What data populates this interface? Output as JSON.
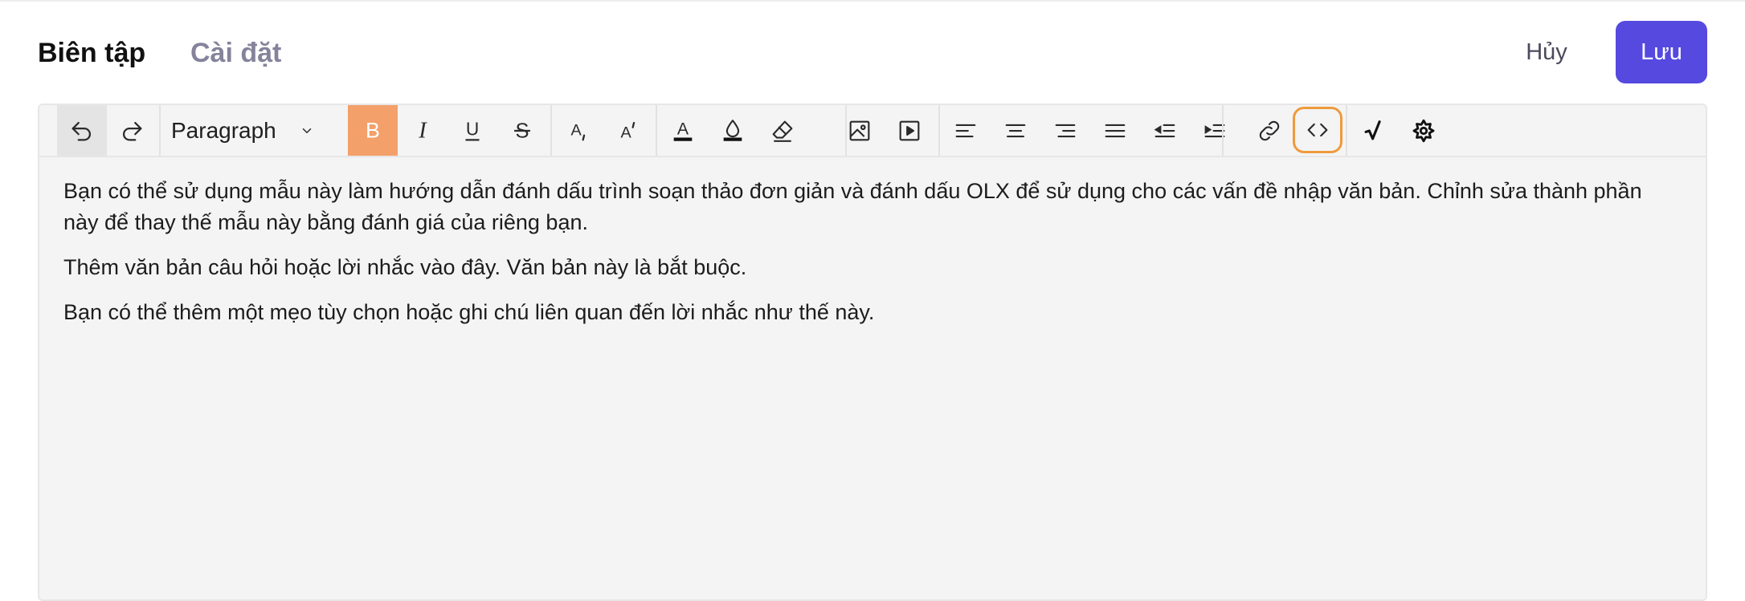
{
  "header": {
    "tabs": [
      {
        "label": "Biên tập",
        "active": true
      },
      {
        "label": "Cài đặt",
        "active": false
      }
    ],
    "cancel_label": "Hủy",
    "save_label": "Lưu"
  },
  "toolbar": {
    "block_format": "Paragraph",
    "buttons": [
      "undo-icon",
      "redo-icon",
      "bold-icon",
      "italic-icon",
      "underline-icon",
      "strikethrough-icon",
      "subscript-icon",
      "superscript-icon",
      "text-color-icon",
      "highlight-icon",
      "eraser-icon",
      "image-icon",
      "video-icon",
      "align-left-icon",
      "align-center-icon",
      "align-right-icon",
      "align-justify-icon",
      "outdent-icon",
      "indent-icon",
      "link-icon",
      "code-icon",
      "math-icon",
      "settings-icon"
    ],
    "letters": {
      "bold": "B",
      "italic": "I",
      "underline": "U",
      "strike": "S",
      "sub": "A",
      "sup": "A",
      "color": "A"
    }
  },
  "content": {
    "paragraphs": [
      "Bạn có thể sử dụng mẫu này làm hướng dẫn đánh dấu trình soạn thảo đơn giản và đánh dấu OLX để sử dụng cho các vấn đề nhập văn bản. Chỉnh sửa thành phần này để thay thế mẫu này bằng đánh giá của riêng bạn.",
      "Thêm văn bản câu hỏi hoặc lời nhắc vào đây. Văn bản này là bắt buộc.",
      "Bạn có thể thêm một mẹo tùy chọn hoặc ghi chú liên quan đến lời nhắc như thế này."
    ]
  },
  "colors": {
    "accent": "#5549e0",
    "bold_active": "#f3a06a",
    "code_focus": "#ef9a3c",
    "inactive_tab": "#85839b"
  }
}
